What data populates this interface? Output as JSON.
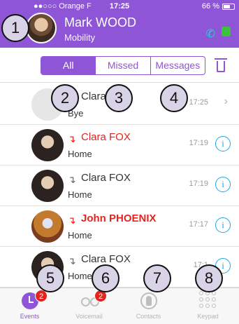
{
  "status_bar": {
    "carrier": "●●○○○ Orange F",
    "time": "17:25",
    "battery": "66 %",
    "battery_fraction": 0.66
  },
  "header": {
    "name": "Mark WOOD",
    "subtitle": "Mobility"
  },
  "filter_tabs": [
    "All",
    "Missed",
    "Messages"
  ],
  "calls": [
    {
      "name": "Clara FOX",
      "sub": "Bye",
      "time": "17:25",
      "type": "normal",
      "action": "chevron",
      "avatar": "placeholder"
    },
    {
      "name": "Clara FOX",
      "sub": "Home",
      "time": "17:19",
      "type": "missed",
      "action": "info",
      "avatar": "clara"
    },
    {
      "name": "Clara FOX",
      "sub": "Home",
      "time": "17:19",
      "type": "normal",
      "action": "info",
      "avatar": "clara"
    },
    {
      "name": "John PHOENIX",
      "sub": "Home",
      "time": "17:17",
      "type": "missed",
      "action": "info",
      "avatar": "john"
    },
    {
      "name": "Clara FOX",
      "sub": "Home",
      "time": "17:1",
      "type": "normal",
      "action": "info",
      "avatar": "clara"
    }
  ],
  "tabbar": [
    {
      "label": "Events",
      "badge": "2"
    },
    {
      "label": "Voicemail",
      "badge": "2"
    },
    {
      "label": "Contacts",
      "badge": ""
    },
    {
      "label": "Keypad",
      "badge": ""
    }
  ],
  "callouts": [
    "1",
    "2",
    "3",
    "4",
    "5",
    "6",
    "7",
    "8"
  ],
  "colors": {
    "accent": "#8e56d6",
    "missed": "#e3241f",
    "info": "#1aa8e8"
  }
}
